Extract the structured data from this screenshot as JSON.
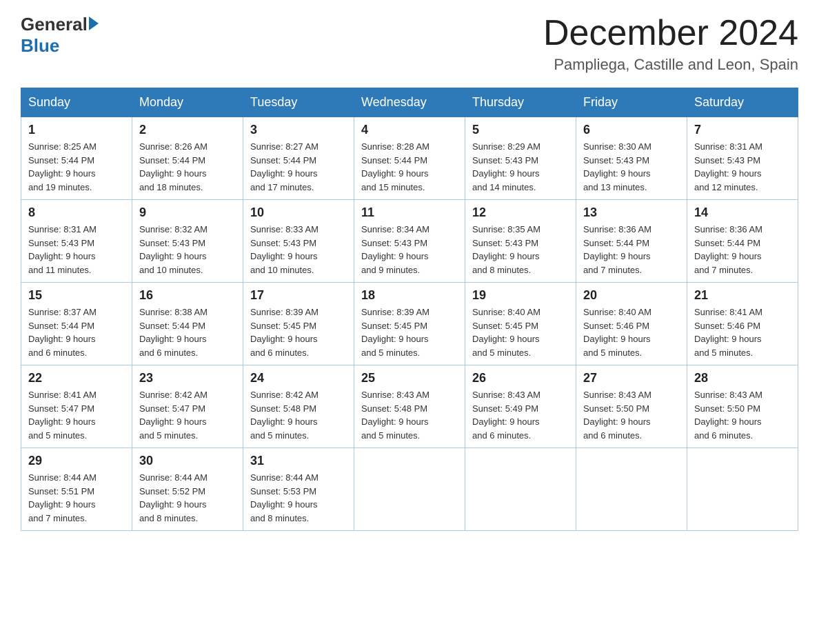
{
  "header": {
    "logo": {
      "general": "General",
      "blue": "Blue"
    },
    "title": "December 2024",
    "subtitle": "Pampliega, Castille and Leon, Spain"
  },
  "days_of_week": [
    "Sunday",
    "Monday",
    "Tuesday",
    "Wednesday",
    "Thursday",
    "Friday",
    "Saturday"
  ],
  "weeks": [
    [
      {
        "day": "1",
        "sunrise": "8:25 AM",
        "sunset": "5:44 PM",
        "daylight": "9 hours and 19 minutes."
      },
      {
        "day": "2",
        "sunrise": "8:26 AM",
        "sunset": "5:44 PM",
        "daylight": "9 hours and 18 minutes."
      },
      {
        "day": "3",
        "sunrise": "8:27 AM",
        "sunset": "5:44 PM",
        "daylight": "9 hours and 17 minutes."
      },
      {
        "day": "4",
        "sunrise": "8:28 AM",
        "sunset": "5:44 PM",
        "daylight": "9 hours and 15 minutes."
      },
      {
        "day": "5",
        "sunrise": "8:29 AM",
        "sunset": "5:43 PM",
        "daylight": "9 hours and 14 minutes."
      },
      {
        "day": "6",
        "sunrise": "8:30 AM",
        "sunset": "5:43 PM",
        "daylight": "9 hours and 13 minutes."
      },
      {
        "day": "7",
        "sunrise": "8:31 AM",
        "sunset": "5:43 PM",
        "daylight": "9 hours and 12 minutes."
      }
    ],
    [
      {
        "day": "8",
        "sunrise": "8:31 AM",
        "sunset": "5:43 PM",
        "daylight": "9 hours and 11 minutes."
      },
      {
        "day": "9",
        "sunrise": "8:32 AM",
        "sunset": "5:43 PM",
        "daylight": "9 hours and 10 minutes."
      },
      {
        "day": "10",
        "sunrise": "8:33 AM",
        "sunset": "5:43 PM",
        "daylight": "9 hours and 10 minutes."
      },
      {
        "day": "11",
        "sunrise": "8:34 AM",
        "sunset": "5:43 PM",
        "daylight": "9 hours and 9 minutes."
      },
      {
        "day": "12",
        "sunrise": "8:35 AM",
        "sunset": "5:43 PM",
        "daylight": "9 hours and 8 minutes."
      },
      {
        "day": "13",
        "sunrise": "8:36 AM",
        "sunset": "5:44 PM",
        "daylight": "9 hours and 7 minutes."
      },
      {
        "day": "14",
        "sunrise": "8:36 AM",
        "sunset": "5:44 PM",
        "daylight": "9 hours and 7 minutes."
      }
    ],
    [
      {
        "day": "15",
        "sunrise": "8:37 AM",
        "sunset": "5:44 PM",
        "daylight": "9 hours and 6 minutes."
      },
      {
        "day": "16",
        "sunrise": "8:38 AM",
        "sunset": "5:44 PM",
        "daylight": "9 hours and 6 minutes."
      },
      {
        "day": "17",
        "sunrise": "8:39 AM",
        "sunset": "5:45 PM",
        "daylight": "9 hours and 6 minutes."
      },
      {
        "day": "18",
        "sunrise": "8:39 AM",
        "sunset": "5:45 PM",
        "daylight": "9 hours and 5 minutes."
      },
      {
        "day": "19",
        "sunrise": "8:40 AM",
        "sunset": "5:45 PM",
        "daylight": "9 hours and 5 minutes."
      },
      {
        "day": "20",
        "sunrise": "8:40 AM",
        "sunset": "5:46 PM",
        "daylight": "9 hours and 5 minutes."
      },
      {
        "day": "21",
        "sunrise": "8:41 AM",
        "sunset": "5:46 PM",
        "daylight": "9 hours and 5 minutes."
      }
    ],
    [
      {
        "day": "22",
        "sunrise": "8:41 AM",
        "sunset": "5:47 PM",
        "daylight": "9 hours and 5 minutes."
      },
      {
        "day": "23",
        "sunrise": "8:42 AM",
        "sunset": "5:47 PM",
        "daylight": "9 hours and 5 minutes."
      },
      {
        "day": "24",
        "sunrise": "8:42 AM",
        "sunset": "5:48 PM",
        "daylight": "9 hours and 5 minutes."
      },
      {
        "day": "25",
        "sunrise": "8:43 AM",
        "sunset": "5:48 PM",
        "daylight": "9 hours and 5 minutes."
      },
      {
        "day": "26",
        "sunrise": "8:43 AM",
        "sunset": "5:49 PM",
        "daylight": "9 hours and 6 minutes."
      },
      {
        "day": "27",
        "sunrise": "8:43 AM",
        "sunset": "5:50 PM",
        "daylight": "9 hours and 6 minutes."
      },
      {
        "day": "28",
        "sunrise": "8:43 AM",
        "sunset": "5:50 PM",
        "daylight": "9 hours and 6 minutes."
      }
    ],
    [
      {
        "day": "29",
        "sunrise": "8:44 AM",
        "sunset": "5:51 PM",
        "daylight": "9 hours and 7 minutes."
      },
      {
        "day": "30",
        "sunrise": "8:44 AM",
        "sunset": "5:52 PM",
        "daylight": "9 hours and 8 minutes."
      },
      {
        "day": "31",
        "sunrise": "8:44 AM",
        "sunset": "5:53 PM",
        "daylight": "9 hours and 8 minutes."
      },
      null,
      null,
      null,
      null
    ]
  ],
  "labels": {
    "sunrise": "Sunrise:",
    "sunset": "Sunset:",
    "daylight": "Daylight:"
  }
}
